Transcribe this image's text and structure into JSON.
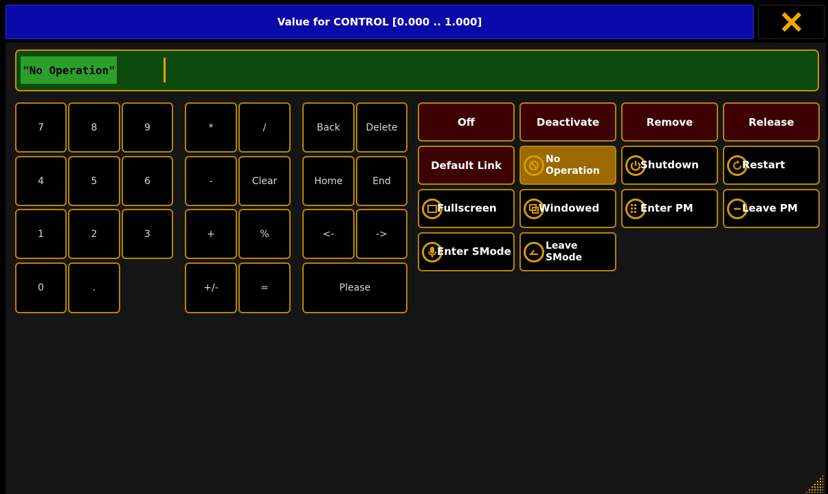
{
  "window": {
    "title": "Value for CONTROL [0.000 .. 1.000]",
    "close_icon": "close-x-icon",
    "accent": "#e8a000",
    "title_bg": "#0a0aa8"
  },
  "input": {
    "value": "\"No Operation\""
  },
  "keypad": {
    "digits": [
      "7",
      "8",
      "9",
      "4",
      "5",
      "6",
      "1",
      "2",
      "3",
      "0",
      "."
    ],
    "ops": [
      "*",
      "/",
      "-",
      "Clear",
      "+",
      "%",
      "+/-",
      "="
    ],
    "nav": [
      "Back",
      "Delete",
      "Home",
      "End",
      "<-",
      "->",
      "Please"
    ]
  },
  "actions": {
    "off": "Off",
    "deactivate": "Deactivate",
    "remove": "Remove",
    "release": "Release",
    "default_link": "Default Link",
    "no_operation": "No Operation",
    "shutdown": "Shutdown",
    "restart": "Restart",
    "fullscreen": "Fullscreen",
    "windowed": "Windowed",
    "enter_pm": "Enter PM",
    "leave_pm": "Leave PM",
    "enter_smode": "Enter SMode",
    "leave_smode": "Leave SMode"
  }
}
